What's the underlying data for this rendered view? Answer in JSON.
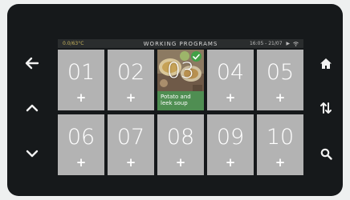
{
  "status": {
    "temperature": "0.0/63°C",
    "title": "WORKING PROGRAMS",
    "datetime": "16:05 - 21/07"
  },
  "nav": {
    "back_icon": "arrow-left-icon",
    "up_icon": "chevron-up-icon",
    "down_icon": "chevron-down-icon",
    "home_icon": "home-icon",
    "sort_icon": "sort-arrows-icon",
    "search_icon": "search-icon"
  },
  "programs": [
    {
      "number": "01",
      "plus": "+"
    },
    {
      "number": "02",
      "plus": "+"
    },
    {
      "number": "03",
      "caption": "Potato and leek soup",
      "selected": true
    },
    {
      "number": "04",
      "plus": "+"
    },
    {
      "number": "05",
      "plus": "+"
    },
    {
      "number": "06",
      "plus": "+"
    },
    {
      "number": "07",
      "plus": "+"
    },
    {
      "number": "08",
      "plus": "+"
    },
    {
      "number": "09",
      "plus": "+"
    },
    {
      "number": "10",
      "plus": "+"
    }
  ],
  "colors": {
    "tile": "#b3b3b3",
    "caption": "#4d9153",
    "check": "#43a047",
    "bezel": "#16191b"
  }
}
